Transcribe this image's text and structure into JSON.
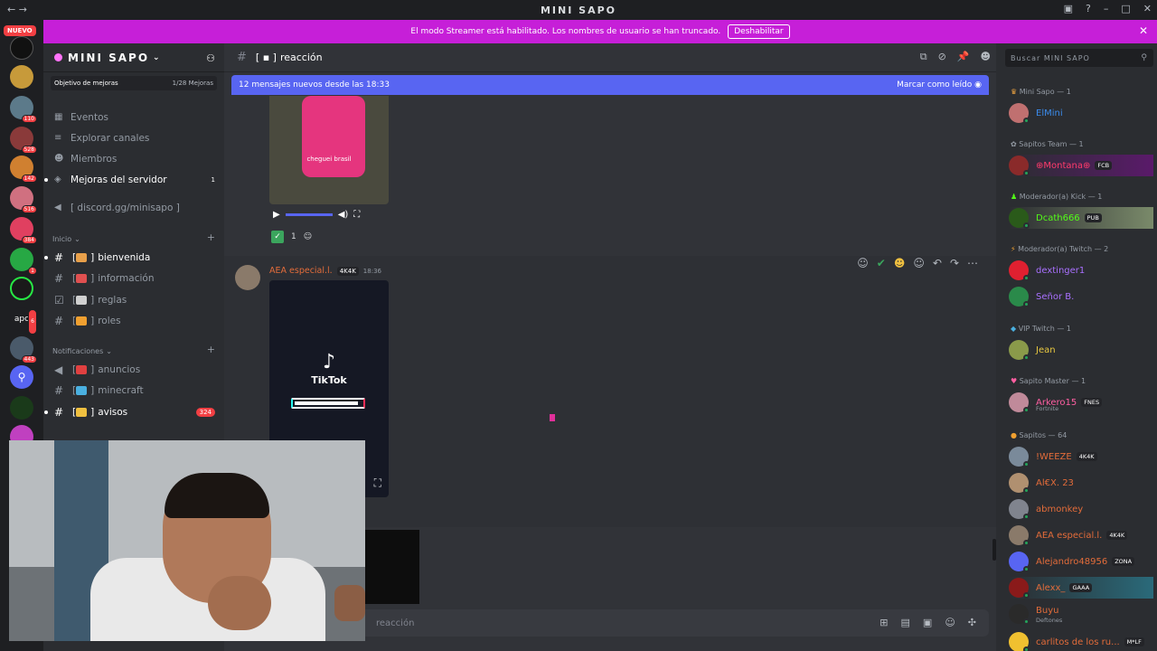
{
  "window": {
    "title": "MINI SAPO"
  },
  "banner": {
    "text": "El modo Streamer está habilitado. Los nombres de usuario se han truncado.",
    "button": "Deshabilitar"
  },
  "servers": {
    "nuevo": "NUEVO",
    "badges": [
      "110",
      "528",
      "142",
      "516",
      "384",
      "1",
      "6",
      "443"
    ],
    "apc_label": "apc"
  },
  "server": {
    "name": "MINI SAPO",
    "boost_goal": "Objetivo de mejoras",
    "boost_count": "1/28 Mejoras"
  },
  "nav": [
    {
      "label": "Eventos"
    },
    {
      "label": "Explorar canales"
    },
    {
      "label": "Miembros"
    },
    {
      "label": "Mejoras del servidor",
      "count": "1"
    },
    {
      "label": "[ discord.gg/minisapo ]"
    }
  ],
  "categories": {
    "inicio": "Inicio",
    "notificaciones": "Notificaciones"
  },
  "channels_inicio": [
    {
      "label": "bienvenida",
      "color": "#e8a04a"
    },
    {
      "label": "información",
      "color": "#e05050"
    },
    {
      "label": "reglas",
      "color": "#d0d0d0"
    },
    {
      "label": "roles",
      "color": "#f0a030"
    }
  ],
  "channels_notif": [
    {
      "label": "anuncios",
      "color": "#e04040"
    },
    {
      "label": "minecraft",
      "color": "#4ab0e0"
    },
    {
      "label": "avisos",
      "color": "#f0c040",
      "badge": "324"
    }
  ],
  "channel": {
    "name": "reacción",
    "new_messages": "12 mensajes nuevos desde las 18:33",
    "mark_read": "Marcar como leído"
  },
  "video": {
    "caption": "cheguei brasil",
    "reaction_count": "1"
  },
  "message": {
    "author": "AEA especial.l.",
    "tag": "4K4K",
    "time": "18:36",
    "tiktok_label": "TikTok"
  },
  "input": {
    "placeholder": "reacción"
  },
  "members": {
    "search_placeholder": "Buscar MINI SAPO",
    "groups": [
      {
        "label": "Mini Sapo — 1",
        "members": [
          {
            "name": "ElMini",
            "color": "#3b8ced"
          }
        ]
      },
      {
        "label": "Sapitos Team — 1",
        "members": [
          {
            "name": "⊕Montana⊕",
            "color": "#ff3b6b",
            "tag": "FCB"
          }
        ]
      },
      {
        "label": "Moderador(a) Kick — 1",
        "members": [
          {
            "name": "Dcath666",
            "color": "#53fc18",
            "tag": "PUB"
          }
        ]
      },
      {
        "label": "Moderador(a) Twitch — 2",
        "members": [
          {
            "name": "dextinger1",
            "color": "#a970ff"
          },
          {
            "name": "Señor B.",
            "color": "#a970ff"
          }
        ]
      },
      {
        "label": "VIP Twitch — 1",
        "members": [
          {
            "name": "Jean",
            "color": "#e8c840"
          }
        ]
      },
      {
        "label": "Sapito Master — 1",
        "members": [
          {
            "name": "Arkero15",
            "color": "#ff5fa2",
            "tag": "FNES",
            "sub": "Fortnite"
          }
        ]
      },
      {
        "label": "Sapitos — 64",
        "members": [
          {
            "name": "!WEEZE",
            "color": "#e36c3a",
            "tag": "4K4K"
          },
          {
            "name": "Al€X. 23",
            "color": "#e36c3a"
          },
          {
            "name": "abmonkey",
            "color": "#e36c3a"
          },
          {
            "name": "AEA especial.l.",
            "color": "#e36c3a",
            "tag": "4K4K"
          },
          {
            "name": "Alejandro48956",
            "color": "#e36c3a",
            "tag": "ZONA"
          },
          {
            "name": "Alexx_",
            "color": "#e36c3a",
            "tag": "GAAA"
          },
          {
            "name": "Buyu",
            "color": "#e36c3a",
            "sub": "Deftones"
          },
          {
            "name": "carlitos de los ru...",
            "color": "#e36c3a",
            "tag": "M*LF"
          }
        ]
      }
    ]
  }
}
